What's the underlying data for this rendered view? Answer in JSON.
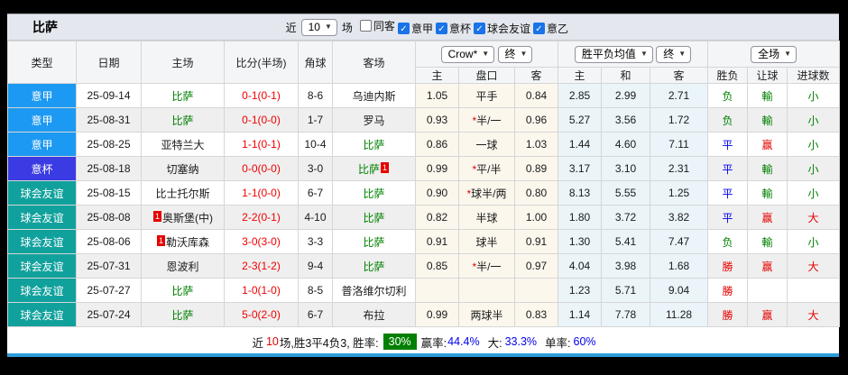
{
  "title": "比萨",
  "controls": {
    "recent_label": "近",
    "recent_value": "10",
    "matches_label": "场",
    "filters": [
      {
        "label": "同客",
        "checked": false
      },
      {
        "label": "意甲",
        "checked": true
      },
      {
        "label": "意杯",
        "checked": true
      },
      {
        "label": "球会友谊",
        "checked": true
      },
      {
        "label": "意乙",
        "checked": true
      }
    ]
  },
  "header": {
    "main": [
      "类型",
      "日期",
      "主场",
      "比分(半场)",
      "角球",
      "客场"
    ],
    "odds_company_select": "Crow*",
    "odds_final_select": "终",
    "avg_select": "胜平负均值",
    "avg_final_select": "终",
    "fulltime_select": "全场",
    "sub": [
      "主",
      "盘口",
      "客",
      "主",
      "和",
      "客",
      "胜负",
      "让球",
      "进球数"
    ]
  },
  "type_colors": {
    "serie-a": "#1c99f2",
    "italy-cup": "#3b3be3",
    "club-friendly": "#11a19d"
  },
  "table": {
    "rows": [
      {
        "type": "意甲",
        "type_key": "serie-a",
        "date": "25-09-14",
        "home": {
          "text": "比萨",
          "self": true
        },
        "score_ft": "0-1",
        "score_ht": "(0-1)",
        "corner": "8-6",
        "away": {
          "text": "乌迪内斯",
          "self": false
        },
        "ah_star": false,
        "ah_home": "1.05",
        "ah_line": "平手",
        "ah_away": "0.84",
        "avg_home": "2.85",
        "avg_draw": "2.99",
        "avg_away": "2.71",
        "res_wdl": {
          "text": "负",
          "color": "green"
        },
        "res_ah": {
          "text": "輸",
          "color": "green"
        },
        "res_ou": {
          "text": "小",
          "color": "green"
        }
      },
      {
        "type": "意甲",
        "type_key": "serie-a",
        "date": "25-08-31",
        "home": {
          "text": "比萨",
          "self": true
        },
        "score_ft": "0-1",
        "score_ht": "(0-0)",
        "corner": "1-7",
        "away": {
          "text": "罗马",
          "self": false
        },
        "ah_star": true,
        "ah_home": "0.93",
        "ah_line": "半/一",
        "ah_away": "0.96",
        "avg_home": "5.27",
        "avg_draw": "3.56",
        "avg_away": "1.72",
        "res_wdl": {
          "text": "负",
          "color": "green"
        },
        "res_ah": {
          "text": "輸",
          "color": "green"
        },
        "res_ou": {
          "text": "小",
          "color": "green"
        }
      },
      {
        "type": "意甲",
        "type_key": "serie-a",
        "date": "25-08-25",
        "home": {
          "text": "亚特兰大",
          "self": false
        },
        "score_ft": "1-1",
        "score_ht": "(0-1)",
        "corner": "10-4",
        "away": {
          "text": "比萨",
          "self": true
        },
        "ah_star": false,
        "ah_home": "0.86",
        "ah_line": "一球",
        "ah_away": "1.03",
        "avg_home": "1.44",
        "avg_draw": "4.60",
        "avg_away": "7.11",
        "res_wdl": {
          "text": "平",
          "color": "blue"
        },
        "res_ah": {
          "text": "赢",
          "color": "red"
        },
        "res_ou": {
          "text": "小",
          "color": "green"
        }
      },
      {
        "type": "意杯",
        "type_key": "italy-cup",
        "date": "25-08-18",
        "home": {
          "text": "切塞纳",
          "self": false
        },
        "score_ft": "0-0",
        "score_ht": "(0-0)",
        "corner": "3-0",
        "away": {
          "text": "比萨",
          "self": true,
          "badge": {
            "text": "1",
            "pos": "after"
          }
        },
        "ah_star": true,
        "ah_home": "0.99",
        "ah_line": "平/半",
        "ah_away": "0.89",
        "avg_home": "3.17",
        "avg_draw": "3.10",
        "avg_away": "2.31",
        "res_wdl": {
          "text": "平",
          "color": "blue"
        },
        "res_ah": {
          "text": "輸",
          "color": "green"
        },
        "res_ou": {
          "text": "小",
          "color": "green"
        }
      },
      {
        "type": "球会友谊",
        "type_key": "club-friendly",
        "date": "25-08-15",
        "home": {
          "text": "比士托尔斯",
          "self": false
        },
        "score_ft": "1-1",
        "score_ht": "(0-0)",
        "corner": "6-7",
        "away": {
          "text": "比萨",
          "self": true
        },
        "ah_star": true,
        "ah_home": "0.90",
        "ah_line": "球半/两",
        "ah_away": "0.80",
        "avg_home": "8.13",
        "avg_draw": "5.55",
        "avg_away": "1.25",
        "res_wdl": {
          "text": "平",
          "color": "blue"
        },
        "res_ah": {
          "text": "輸",
          "color": "green"
        },
        "res_ou": {
          "text": "小",
          "color": "green"
        }
      },
      {
        "type": "球会友谊",
        "type_key": "club-friendly",
        "date": "25-08-08",
        "home": {
          "text": "奥斯堡(中)",
          "self": false,
          "badge": {
            "text": "1",
            "pos": "before"
          }
        },
        "score_ft": "2-2",
        "score_ht": "(0-1)",
        "corner": "4-10",
        "away": {
          "text": "比萨",
          "self": true
        },
        "ah_star": false,
        "ah_home": "0.82",
        "ah_line": "半球",
        "ah_away": "1.00",
        "avg_home": "1.80",
        "avg_draw": "3.72",
        "avg_away": "3.82",
        "res_wdl": {
          "text": "平",
          "color": "blue"
        },
        "res_ah": {
          "text": "赢",
          "color": "red"
        },
        "res_ou": {
          "text": "大",
          "color": "red"
        }
      },
      {
        "type": "球会友谊",
        "type_key": "club-friendly",
        "date": "25-08-06",
        "home": {
          "text": "勒沃库森",
          "self": false,
          "badge": {
            "text": "1",
            "pos": "before"
          }
        },
        "score_ft": "3-0",
        "score_ht": "(3-0)",
        "corner": "3-3",
        "away": {
          "text": "比萨",
          "self": true
        },
        "ah_star": false,
        "ah_home": "0.91",
        "ah_line": "球半",
        "ah_away": "0.91",
        "avg_home": "1.30",
        "avg_draw": "5.41",
        "avg_away": "7.47",
        "res_wdl": {
          "text": "负",
          "color": "green"
        },
        "res_ah": {
          "text": "輸",
          "color": "green"
        },
        "res_ou": {
          "text": "小",
          "color": "green"
        }
      },
      {
        "type": "球会友谊",
        "type_key": "club-friendly",
        "date": "25-07-31",
        "home": {
          "text": "恩波利",
          "self": false
        },
        "score_ft": "2-3",
        "score_ht": "(1-2)",
        "corner": "9-4",
        "away": {
          "text": "比萨",
          "self": true
        },
        "ah_star": true,
        "ah_home": "0.85",
        "ah_line": "半/一",
        "ah_away": "0.97",
        "avg_home": "4.04",
        "avg_draw": "3.98",
        "avg_away": "1.68",
        "res_wdl": {
          "text": "勝",
          "color": "red"
        },
        "res_ah": {
          "text": "赢",
          "color": "red"
        },
        "res_ou": {
          "text": "大",
          "color": "red"
        }
      },
      {
        "type": "球会友谊",
        "type_key": "club-friendly",
        "date": "25-07-27",
        "home": {
          "text": "比萨",
          "self": true
        },
        "score_ft": "1-0",
        "score_ht": "(1-0)",
        "corner": "8-5",
        "away": {
          "text": "普洛维尔切利",
          "self": false
        },
        "ah_star": false,
        "ah_home": "",
        "ah_line": "",
        "ah_away": "",
        "avg_home": "1.23",
        "avg_draw": "5.71",
        "avg_away": "9.04",
        "res_wdl": {
          "text": "勝",
          "color": "red"
        },
        "res_ah": {
          "text": "",
          "color": "green"
        },
        "res_ou": {
          "text": "",
          "color": "green"
        }
      },
      {
        "type": "球会友谊",
        "type_key": "club-friendly",
        "date": "25-07-24",
        "home": {
          "text": "比萨",
          "self": true
        },
        "score_ft": "5-0",
        "score_ht": "(2-0)",
        "corner": "6-7",
        "away": {
          "text": "布拉",
          "self": false
        },
        "ah_star": false,
        "ah_home": "0.99",
        "ah_line": "两球半",
        "ah_away": "0.83",
        "avg_home": "1.14",
        "avg_draw": "7.78",
        "avg_away": "11.28",
        "res_wdl": {
          "text": "勝",
          "color": "red"
        },
        "res_ah": {
          "text": "赢",
          "color": "red"
        },
        "res_ou": {
          "text": "大",
          "color": "red"
        }
      }
    ]
  },
  "footer": {
    "recent_label": "近",
    "recent_num": "10",
    "summary": "场,胜3平4负3, 胜率:",
    "win_rate": "30%",
    "ah_label": "赢率:",
    "ah_value": "44.4%",
    "ou_label": "大:",
    "ou_value": "33.3%",
    "single_label": "单率:",
    "single_value": "60%"
  }
}
